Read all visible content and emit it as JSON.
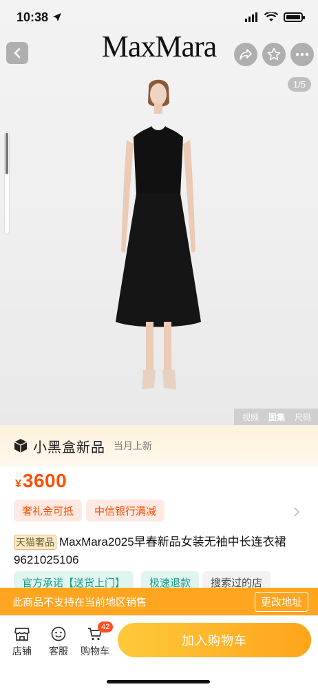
{
  "status_bar": {
    "time": "10:38"
  },
  "header": {
    "brand": "MaxMara",
    "image_counter": "1/5",
    "icons": [
      "back-icon",
      "share-icon",
      "star-icon",
      "more-icon"
    ]
  },
  "media_tabs": {
    "video": "视频",
    "gallery": "图集",
    "size": "尺码",
    "active": "图集"
  },
  "promo": {
    "title": "小黑盒新品",
    "subtitle": "当月上新"
  },
  "price": {
    "currency": "¥",
    "amount": "3600"
  },
  "coupons": [
    "奢礼金可抵",
    "中信银行满减"
  ],
  "product": {
    "tag": "天猫奢品",
    "title": "MaxMara2025早春新品女装无袖中长连衣裙9621025106"
  },
  "service_tags": [
    "官方承诺【送货上门】",
    "极速退款",
    "搜索过的店"
  ],
  "region_notice": {
    "text": "此商品不支持在当前地区销售",
    "button": "更改地址"
  },
  "bottom_bar": {
    "store": "店铺",
    "service": "客服",
    "cart": "购物车",
    "cart_count": "42",
    "add_to_cart": "加入购物车"
  },
  "colors": {
    "accent_orange": "#ff5000",
    "notice_orange": "#ffa51f",
    "cart_gradient_start": "#ffc93b",
    "cart_gradient_end": "#ffa41b",
    "green_tag": "#16a085"
  }
}
